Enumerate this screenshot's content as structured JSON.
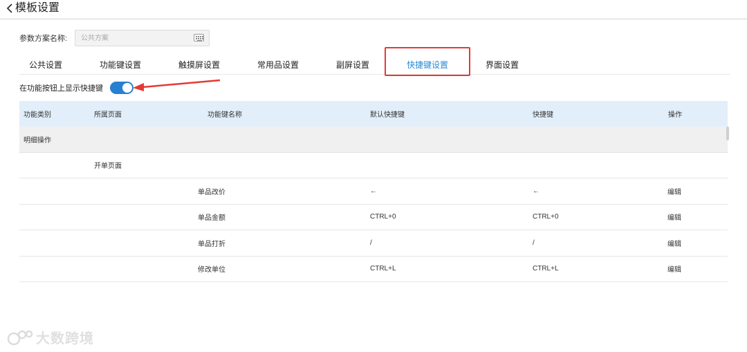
{
  "header": {
    "title": "模板设置"
  },
  "scheme": {
    "label": "参数方案名称:",
    "placeholder": "公共方案"
  },
  "tabs": [
    {
      "label": "公共设置"
    },
    {
      "label": "功能键设置"
    },
    {
      "label": "触摸屏设置"
    },
    {
      "label": "常用品设置"
    },
    {
      "label": "副屏设置"
    },
    {
      "label": "快捷键设置",
      "active": true
    },
    {
      "label": "界面设置"
    }
  ],
  "toggle": {
    "label": "在功能按钮上显示快捷键",
    "on": true
  },
  "table": {
    "headers": {
      "category": "功能类别",
      "page": "所属页面",
      "name": "功能键名称",
      "default": "默认快捷键",
      "shortcut": "快捷键",
      "op": "操作"
    },
    "group": "明细操作",
    "subgroup": "开单页面",
    "rows": [
      {
        "name": "单品改价",
        "default": "←",
        "shortcut": "←",
        "op": "编辑"
      },
      {
        "name": "单品金额",
        "default": "CTRL+0",
        "shortcut": "CTRL+0",
        "op": "编辑"
      },
      {
        "name": "单品打折",
        "default": "/",
        "shortcut": "/",
        "op": "编辑"
      },
      {
        "name": "修改单位",
        "default": "CTRL+L",
        "shortcut": "CTRL+L",
        "op": "编辑"
      }
    ]
  },
  "watermark": {
    "text": "大数跨境"
  },
  "colors": {
    "accent": "#2a80d0",
    "highlight": "#e53935",
    "header_bg": "#e2effa"
  }
}
